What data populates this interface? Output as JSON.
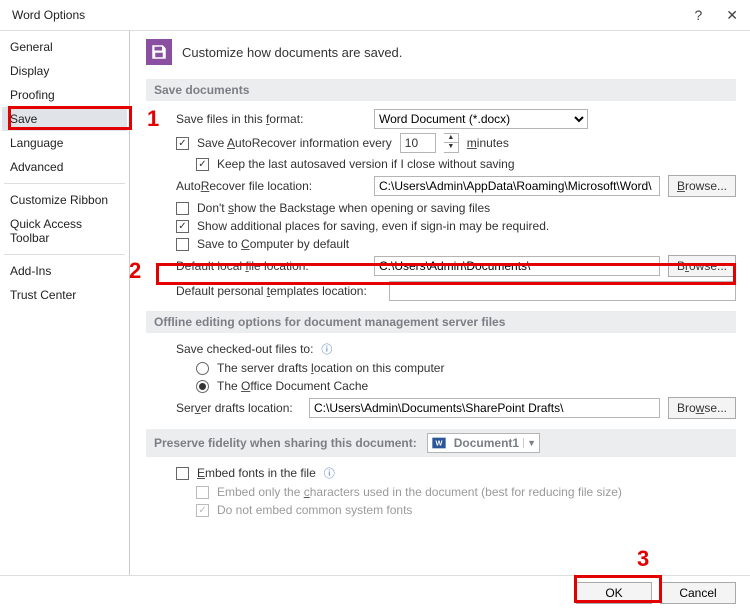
{
  "title": "Word Options",
  "title_help": "?",
  "title_close": "✕",
  "sidebar": {
    "items": [
      {
        "label": "General"
      },
      {
        "label": "Display"
      },
      {
        "label": "Proofing"
      },
      {
        "label": "Save",
        "selected": true
      },
      {
        "label": "Language"
      },
      {
        "label": "Advanced"
      },
      {
        "label": "Customize Ribbon"
      },
      {
        "label": "Quick Access Toolbar"
      },
      {
        "label": "Add-Ins"
      },
      {
        "label": "Trust Center"
      }
    ]
  },
  "header_desc": "Customize how documents are saved.",
  "sections": {
    "save_docs": "Save documents",
    "offline": "Offline editing options for document management server files",
    "preserve": "Preserve fidelity when sharing this document:"
  },
  "save": {
    "fmt_label": "Save files in this format:",
    "fmt_value": "Word Document (*.docx)",
    "autorec_label_pre": "Save AutoRecover information every",
    "autorec_minutes": "10",
    "autorec_label_post": "minutes",
    "keep_last": "Keep the last autosaved version if I close without saving",
    "autorec_loc_label": "AutoRecover file location:",
    "autorec_loc": "C:\\Users\\Admin\\AppData\\Roaming\\Microsoft\\Word\\",
    "dont_show_back": "Don't show the Backstage when opening or saving files",
    "show_addl": "Show additional places for saving, even if sign-in may be required.",
    "save_computer": "Save to Computer by default",
    "def_local_label": "Default local file location:",
    "def_local": "C:\\Users\\Admin\\Documents\\",
    "def_templates_label": "Default personal templates location:",
    "def_templates": ""
  },
  "offline": {
    "save_checked_label": "Save checked-out files to:",
    "opt_server_drafts": "The server drafts location on this computer",
    "opt_office_cache": "The Office Document Cache",
    "server_drafts_label": "Server drafts location:",
    "server_drafts": "C:\\Users\\Admin\\Documents\\SharePoint Drafts\\"
  },
  "preserve": {
    "doc_name": "Document1",
    "embed_fonts": "Embed fonts in the file",
    "embed_only": "Embed only the characters used in the document (best for reducing file size)",
    "do_not_embed_common": "Do not embed common system fonts"
  },
  "buttons": {
    "browse": "Browse...",
    "ok": "OK",
    "cancel": "Cancel"
  },
  "annotations": {
    "n1": "1",
    "n2": "2",
    "n3": "3"
  }
}
